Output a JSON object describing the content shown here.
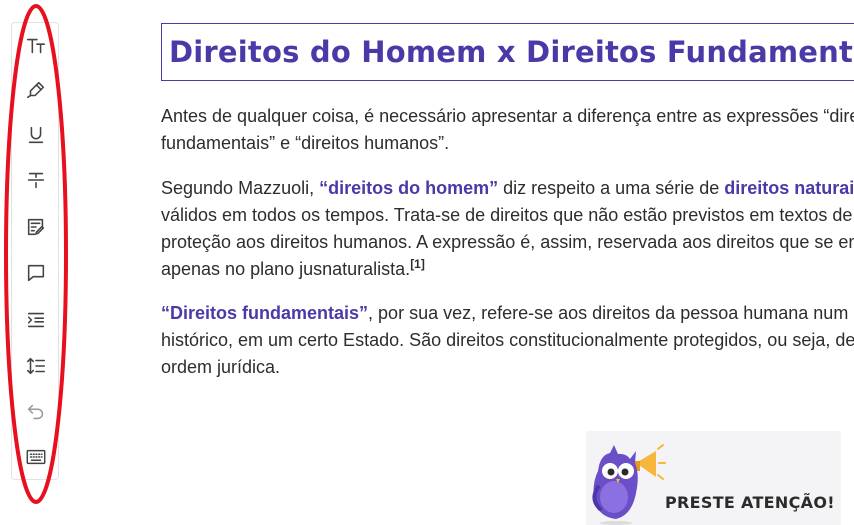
{
  "toolbar": {
    "tools": [
      {
        "icon": "text-size-icon"
      },
      {
        "icon": "highlighter-icon"
      },
      {
        "icon": "underline-icon"
      },
      {
        "icon": "strikethrough-icon"
      },
      {
        "icon": "note-edit-icon"
      },
      {
        "icon": "comment-icon"
      },
      {
        "icon": "indent-icon"
      },
      {
        "icon": "line-spacing-icon"
      },
      {
        "icon": "undo-icon"
      },
      {
        "icon": "keyboard-icon"
      }
    ]
  },
  "colors": {
    "accent": "#4a3aa8",
    "annotation": "#e8101e",
    "text": "#2d2d2d"
  },
  "article": {
    "title": "Direitos do Homem x Direitos Fundamentais",
    "p1": {
      "line1": "Antes de qualquer coisa, é necessário apresentar a diferença entre as expressões “direitos",
      "line2": "fundamentais” e “direitos humanos”."
    },
    "p2": {
      "l1_a": "Segundo Mazzuoli, ",
      "l1_b": "“direitos do homem”",
      "l1_c": " diz respeito a uma série de ",
      "l1_d": "direitos naturais",
      "line2": "válidos em todos os tempos. Trata-se de direitos que não estão previstos em textos de",
      "line3": "proteção aos direitos humanos. A expressão é, assim, reservada aos direitos que se encontram",
      "line4": "apenas no plano jusnaturalista.",
      "footnote": "[1]"
    },
    "p3": {
      "l1_a": "“Direitos fundamentais”",
      "l1_b": ", por sua vez, refere-se aos direitos da pessoa humana num dado momento",
      "line2": "histórico, em um certo Estado. São direitos constitucionalmente protegidos, ou seja, de uma",
      "line3": "ordem jurídica."
    }
  },
  "callout": {
    "label": "PRESTE ATENÇÃO!"
  }
}
